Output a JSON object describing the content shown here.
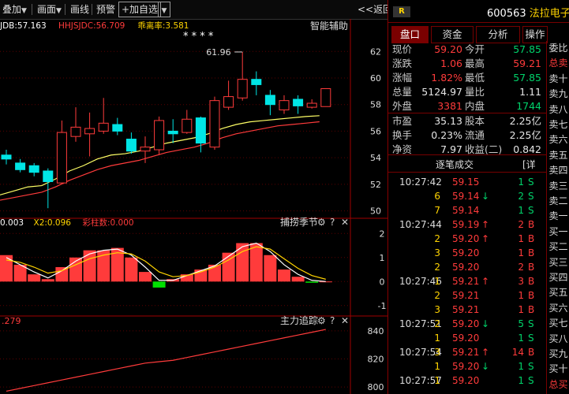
{
  "toolbar": {
    "overlay_label": "叠加",
    "screen_label": "画面",
    "drawline_label": "画线",
    "alert_label": "预警",
    "add_watch_label": "+加自选",
    "back_label": "<<返回"
  },
  "indicators": {
    "main_legend": [
      {
        "text": "JDB:57.163",
        "color": "#ffffff"
      },
      {
        "text": "HHJSJDC:56.709",
        "color": "#ff3b3b"
      },
      {
        "text": "乖离率:3.581",
        "color": "#ffd400"
      }
    ],
    "stars": "* * * *",
    "smart_assist": "智能辅助",
    "peak_label": "61.96",
    "price_axis": [
      "62",
      "60",
      "58",
      "56",
      "54",
      "52",
      "50"
    ],
    "sub1_legend": [
      {
        "text": "0.003",
        "color": "#ffffff"
      },
      {
        "text": "X2:0.096",
        "color": "#ffd400"
      },
      {
        "text": "彩柱数:0.000",
        "color": "#ff3b3b"
      }
    ],
    "sub1_title": "捕捞季节",
    "sub1_axis": [
      "2",
      "1",
      "0",
      "-1"
    ],
    "sub2_legend": ".279",
    "sub2_title": "主力追踪",
    "sub2_axis": [
      "840",
      "820",
      "800"
    ],
    "panel_icons": {
      "gear": "⚙",
      "help": "?",
      "close": "✕"
    }
  },
  "quote": {
    "header_badge": "R",
    "code": "600563",
    "name": "法拉电子",
    "tabs": [
      "盘口",
      "资金",
      "分析",
      "操作"
    ],
    "active_tab": 0,
    "rows": [
      {
        "l1": "现价",
        "v1": "59.20",
        "c1": "red",
        "l2": "今开",
        "v2": "57.85",
        "c2": "green"
      },
      {
        "l1": "涨跌",
        "v1": "1.06",
        "c1": "red",
        "l2": "最高",
        "v2": "59.21",
        "c2": "red"
      },
      {
        "l1": "涨幅",
        "v1": "1.82%",
        "c1": "red",
        "l2": "最低",
        "v2": "57.85",
        "c2": "green"
      },
      {
        "l1": "总量",
        "v1": "5124.97",
        "c1": "white",
        "l2": "量比",
        "v2": "1.11",
        "c2": "white"
      },
      {
        "l1": "外盘",
        "v1": "3381",
        "c1": "red",
        "l2": "内盘",
        "v2": "1744",
        "c2": "green"
      }
    ],
    "rows2": [
      {
        "l1": "市盈",
        "v1": "35.13",
        "l2": "股本",
        "v2": "2.25亿"
      },
      {
        "l1": "换手",
        "v1": "0.23%",
        "l2": "流通",
        "v2": "2.25亿"
      },
      {
        "l1": "净资",
        "v1": "7.97",
        "l2": "收益(二)",
        "v2": "0.842"
      }
    ],
    "trades_title": "逐笔成交",
    "trades_detail": "[详",
    "trades": [
      {
        "time": "10:27:42",
        "price": "59.15",
        "arrow": "",
        "vol": "1",
        "side": "S"
      },
      {
        "time": "",
        "price": "59.14",
        "arrow": "down",
        "vol": "2",
        "side": "S"
      },
      {
        "time": "",
        "price": "59.14",
        "arrow": "",
        "vol": "1",
        "side": "S"
      },
      {
        "time": "10:27:44",
        "price": "59.19",
        "arrow": "up",
        "vol": "2",
        "side": "B"
      },
      {
        "time": "",
        "price": "59.20",
        "arrow": "up",
        "vol": "1",
        "side": "B"
      },
      {
        "time": "",
        "price": "59.20",
        "arrow": "",
        "vol": "1",
        "side": "B"
      },
      {
        "time": "",
        "price": "59.20",
        "arrow": "",
        "vol": "2",
        "side": "B"
      },
      {
        "time": "10:27:46",
        "price": "59.21",
        "arrow": "up",
        "vol": "3",
        "side": "B"
      },
      {
        "time": "",
        "price": "59.21",
        "arrow": "",
        "vol": "1",
        "side": "B"
      },
      {
        "time": "",
        "price": "59.21",
        "arrow": "",
        "vol": "1",
        "side": "B"
      },
      {
        "time": "10:27:51",
        "price": "59.20",
        "arrow": "down",
        "vol": "5",
        "side": "S"
      },
      {
        "time": "",
        "price": "59.20",
        "arrow": "",
        "vol": "1",
        "side": "S"
      },
      {
        "time": "10:27:54",
        "price": "59.21",
        "arrow": "up",
        "vol": "14",
        "side": "B"
      },
      {
        "time": "",
        "price": "59.20",
        "arrow": "down",
        "vol": "1",
        "side": "S"
      },
      {
        "time": "10:27:57",
        "price": "59.20",
        "arrow": "",
        "vol": "1",
        "side": "S"
      }
    ],
    "trade_vol_prefix": [
      "",
      "6",
      "7",
      "",
      "2",
      "3",
      "2",
      "1",
      "2",
      "3",
      "2",
      "1",
      "3",
      "1",
      "1"
    ],
    "side_list": [
      "委比",
      "总卖",
      "卖十",
      "卖九",
      "卖八",
      "卖七",
      "卖六",
      "卖五",
      "卖四",
      "卖三",
      "卖二",
      "卖一",
      "买一",
      "买二",
      "买三",
      "买四",
      "买五",
      "买六",
      "买七",
      "买八",
      "买九",
      "买十",
      "总买"
    ],
    "side_highlight": [
      1,
      22
    ]
  },
  "colors": {
    "up": "#ff3b3b",
    "down": "#00e5e5",
    "bg": "#000000",
    "grid": "#5a0000"
  },
  "chart_data": [
    {
      "type": "candlestick",
      "title": "",
      "y_axis_ticks": [
        62,
        60,
        58,
        56,
        54,
        52,
        50
      ],
      "ylim": [
        49.5,
        63.5
      ],
      "candles": [
        {
          "o": 54.2,
          "c": 53.9,
          "h": 54.6,
          "l": 53.5
        },
        {
          "o": 53.6,
          "c": 53.1,
          "h": 53.9,
          "l": 52.9
        },
        {
          "o": 53.4,
          "c": 52.9,
          "h": 53.6,
          "l": 52.6
        },
        {
          "o": 53.0,
          "c": 52.2,
          "h": 53.2,
          "l": 50.2
        },
        {
          "o": 52.1,
          "c": 55.9,
          "h": 56.8,
          "l": 52.0
        },
        {
          "o": 55.6,
          "c": 56.3,
          "h": 57.8,
          "l": 55.2
        },
        {
          "o": 55.8,
          "c": 56.2,
          "h": 57.4,
          "l": 54.1
        },
        {
          "o": 56.0,
          "c": 56.6,
          "h": 58.5,
          "l": 55.8
        },
        {
          "o": 56.5,
          "c": 56.0,
          "h": 57.0,
          "l": 55.7
        },
        {
          "o": 55.4,
          "c": 54.5,
          "h": 55.9,
          "l": 54.3
        },
        {
          "o": 54.5,
          "c": 54.8,
          "h": 55.6,
          "l": 53.6
        },
        {
          "o": 54.6,
          "c": 56.8,
          "h": 57.1,
          "l": 54.2
        },
        {
          "o": 56.0,
          "c": 55.8,
          "h": 56.9,
          "l": 55.1
        },
        {
          "o": 55.9,
          "c": 56.9,
          "h": 57.6,
          "l": 55.8
        },
        {
          "o": 57.0,
          "c": 55.1,
          "h": 57.1,
          "l": 54.4
        },
        {
          "o": 54.8,
          "c": 58.3,
          "h": 58.6,
          "l": 54.6
        },
        {
          "o": 57.8,
          "c": 58.6,
          "h": 59.8,
          "l": 57.6
        },
        {
          "o": 58.5,
          "c": 59.9,
          "h": 61.96,
          "l": 58.3
        },
        {
          "o": 59.9,
          "c": 59.5,
          "h": 60.5,
          "l": 58.7
        },
        {
          "o": 58.7,
          "c": 58.0,
          "h": 59.1,
          "l": 57.2
        },
        {
          "o": 57.6,
          "c": 58.3,
          "h": 58.7,
          "l": 57.3
        },
        {
          "o": 58.4,
          "c": 57.9,
          "h": 58.7,
          "l": 57.3
        },
        {
          "o": 57.8,
          "c": 58.1,
          "h": 58.4,
          "l": 57.7
        },
        {
          "o": 57.85,
          "c": 59.2,
          "h": 59.21,
          "l": 57.85
        }
      ],
      "series": [
        {
          "name": "JDB",
          "values": [
            51.2,
            51.5,
            51.8,
            51.9,
            52.4,
            53.0,
            53.4,
            53.9,
            54.2,
            54.3,
            54.5,
            54.8,
            55.1,
            55.3,
            55.5,
            55.8,
            56.2,
            56.5,
            56.7,
            56.8,
            56.9,
            57.0,
            57.1,
            57.163
          ]
        },
        {
          "name": "HHJSJDC",
          "values": [
            50.8,
            51.0,
            51.2,
            51.4,
            51.8,
            52.3,
            52.7,
            53.1,
            53.4,
            53.6,
            53.8,
            54.1,
            54.4,
            54.6,
            54.8,
            55.1,
            55.5,
            55.8,
            56.0,
            56.2,
            56.4,
            56.5,
            56.6,
            56.709
          ]
        }
      ]
    },
    {
      "type": "bar",
      "title": "捕捞季节",
      "y_axis_ticks": [
        2,
        1,
        0,
        -1
      ],
      "ylim": [
        -1.4,
        2.6
      ],
      "values": [
        1.1,
        0.7,
        0.3,
        0.1,
        0.6,
        1.0,
        1.3,
        1.3,
        1.4,
        1.0,
        0.4,
        -0.25,
        0.1,
        0.3,
        0.5,
        0.7,
        1.2,
        1.6,
        1.6,
        1.1,
        0.5,
        0.2,
        -0.05,
        0.003
      ],
      "series": [
        {
          "name": "",
          "values": [
            1.0,
            0.7,
            0.4,
            0.15,
            0.45,
            0.85,
            1.15,
            1.3,
            1.35,
            1.1,
            0.6,
            0.05,
            0.05,
            0.25,
            0.45,
            0.65,
            1.05,
            1.45,
            1.6,
            1.25,
            0.7,
            0.3,
            0.05,
            0.003
          ]
        },
        {
          "name": "X2",
          "values": [
            0.9,
            0.8,
            0.6,
            0.35,
            0.45,
            0.7,
            0.95,
            1.1,
            1.2,
            1.15,
            0.85,
            0.4,
            0.2,
            0.25,
            0.4,
            0.6,
            0.9,
            1.25,
            1.45,
            1.35,
            0.95,
            0.55,
            0.25,
            0.096
          ]
        }
      ]
    },
    {
      "type": "line",
      "title": "主力追踪",
      "y_axis_ticks": [
        840,
        820,
        800
      ],
      "ylim": [
        795,
        850
      ],
      "series": [
        {
          "name": "",
          "values": [
            797,
            799,
            801,
            803,
            805,
            807,
            809,
            811,
            813,
            815,
            817,
            818,
            819,
            821,
            823,
            825,
            827,
            829,
            831,
            833,
            835,
            837,
            839,
            841
          ]
        }
      ]
    }
  ]
}
